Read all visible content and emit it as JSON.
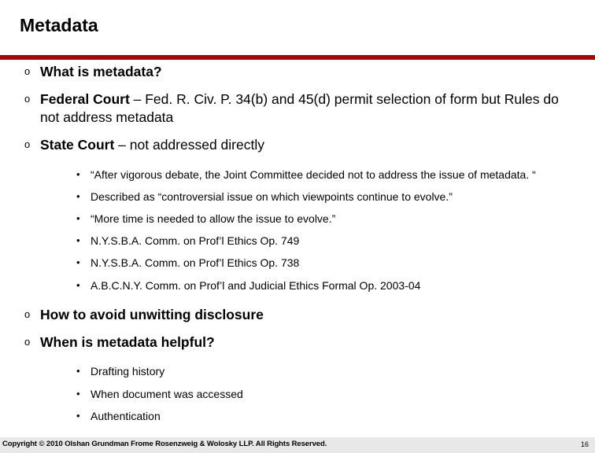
{
  "slide": {
    "title": "Metadata",
    "accent_color": "#9e0b0b",
    "background_color": "#ffffff",
    "footer_background_color": "#e8e8e8",
    "level1_marker": "o",
    "level2_marker": "•"
  },
  "content": {
    "b1": {
      "lead": "What is metadata?",
      "rest": ""
    },
    "b2": {
      "lead": "Federal Court",
      "rest": " – Fed. R. Civ. P. 34(b) and 45(d) permit selection of form but Rules do not address metadata"
    },
    "b3": {
      "lead": "State Court",
      "rest": " – not addressed directly"
    },
    "sub": [
      {
        "text": "“After vigorous debate, the Joint Committee decided not to address the issue of metadata. “"
      },
      {
        "text": "Described as “controversial issue on which viewpoints continue to evolve.”"
      },
      {
        "text": "“More time is needed to allow the issue to evolve.”"
      },
      {
        "text": "N.Y.S.B.A. Comm. on Prof’l Ethics Op. 749"
      },
      {
        "text": "N.Y.S.B.A. Comm. on Prof’l Ethics Op. 738"
      },
      {
        "text": "A.B.C.N.Y. Comm. on Prof’l and Judicial Ethics Formal Op. 2003-04"
      }
    ],
    "b4": {
      "lead": "How to avoid unwitting disclosure",
      "rest": ""
    },
    "b5": {
      "lead": "When is metadata helpful?",
      "rest": ""
    },
    "sub2": [
      {
        "text": "Drafting history"
      },
      {
        "text": "When document was accessed"
      },
      {
        "text": "Authentication"
      }
    ]
  },
  "footer": {
    "copyright": "Copyright © 2010 Olshan Grundman Frome Rosenzweig & Wolosky LLP. All Rights Reserved.",
    "page_number": "16"
  }
}
